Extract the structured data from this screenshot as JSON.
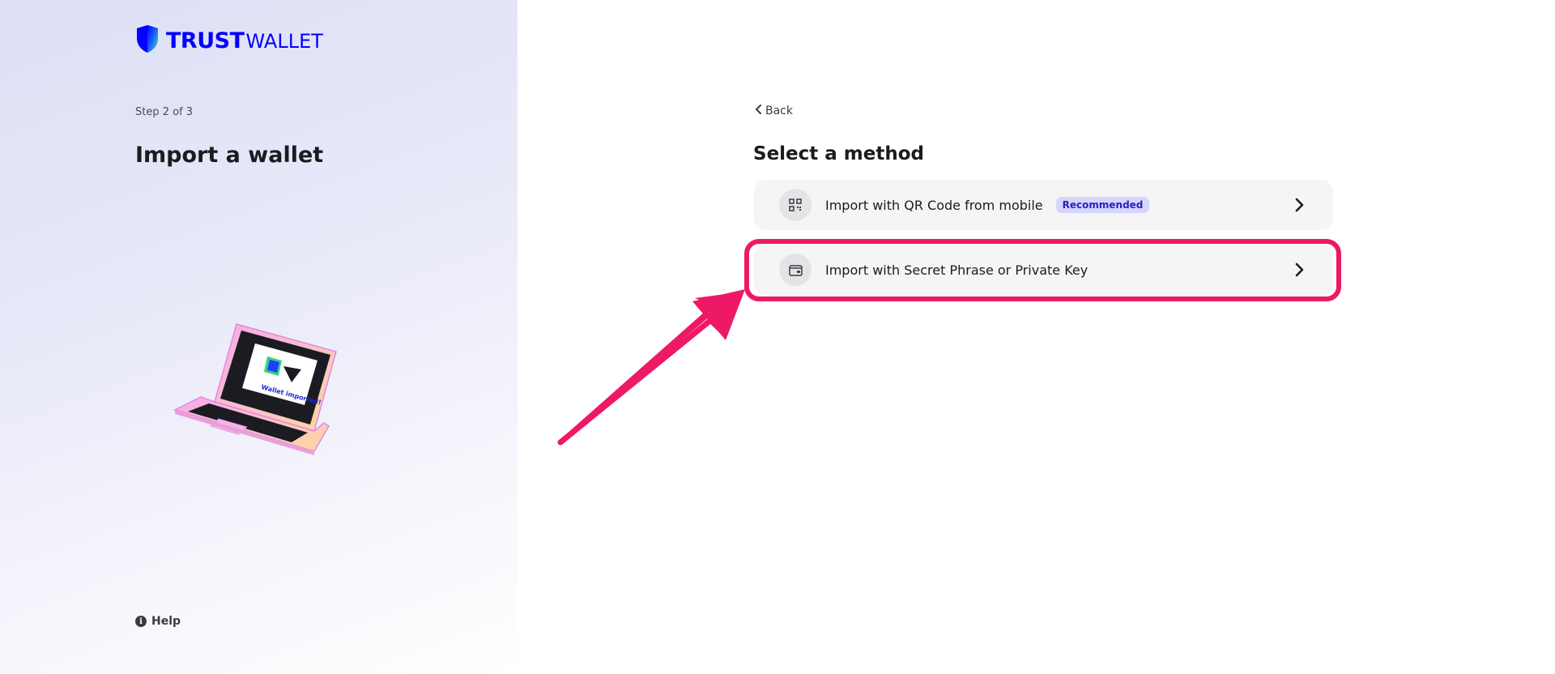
{
  "brand": {
    "name_bold": "TRUST",
    "name_light": "WALLET",
    "accent_color": "#0500ff"
  },
  "left": {
    "step": "Step 2 of 3",
    "title": "Import a wallet",
    "illustration_caption": "Wallet imported!",
    "help_label": "Help"
  },
  "right": {
    "back_label": "Back",
    "title": "Select a method",
    "methods": [
      {
        "label": "Import with QR Code from mobile",
        "badge": "Recommended",
        "icon": "qr-code-icon"
      },
      {
        "label": "Import with Secret Phrase or Private Key",
        "badge": "",
        "icon": "wallet-icon"
      }
    ]
  },
  "annotation": {
    "highlight_color": "#ee1966"
  }
}
